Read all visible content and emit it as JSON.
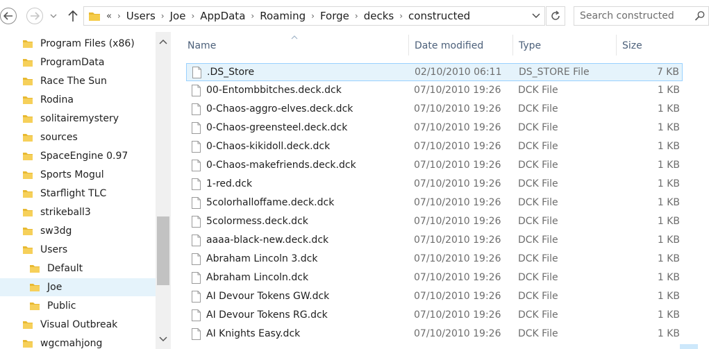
{
  "address": {
    "overflow": "«",
    "crumbs": [
      "Users",
      "Joe",
      "AppData",
      "Roaming",
      "Forge",
      "decks",
      "constructed"
    ]
  },
  "search": {
    "placeholder": "Search constructed"
  },
  "nav": {
    "items": [
      {
        "label": "Program Files (x86)",
        "indent": 0
      },
      {
        "label": "ProgramData",
        "indent": 0
      },
      {
        "label": "Race The Sun",
        "indent": 0
      },
      {
        "label": "Rodina",
        "indent": 0
      },
      {
        "label": "solitairemystery",
        "indent": 0
      },
      {
        "label": "sources",
        "indent": 0
      },
      {
        "label": "SpaceEngine 0.97",
        "indent": 0
      },
      {
        "label": "Sports Mogul",
        "indent": 0
      },
      {
        "label": "Starflight TLC",
        "indent": 0
      },
      {
        "label": "strikeball3",
        "indent": 0
      },
      {
        "label": "sw3dg",
        "indent": 0
      },
      {
        "label": "Users",
        "indent": 0
      },
      {
        "label": "Default",
        "indent": 1
      },
      {
        "label": "Joe",
        "indent": 1,
        "selected": true
      },
      {
        "label": "Public",
        "indent": 1
      },
      {
        "label": "Visual Outbreak",
        "indent": 0
      },
      {
        "label": "wgcmahjong",
        "indent": 0
      }
    ]
  },
  "columns": {
    "name": "Name",
    "date": "Date modified",
    "type": "Type",
    "size": "Size"
  },
  "files": [
    {
      "name": ".DS_Store",
      "date": "02/10/2010 06:11",
      "type": "DS_STORE File",
      "size": "7 KB",
      "selected": true
    },
    {
      "name": "00-Entombbitches.deck.dck",
      "date": "07/10/2010 19:26",
      "type": "DCK File",
      "size": "1 KB"
    },
    {
      "name": "0-Chaos-aggro-elves.deck.dck",
      "date": "07/10/2010 19:26",
      "type": "DCK File",
      "size": "1 KB"
    },
    {
      "name": "0-Chaos-greensteel.deck.dck",
      "date": "07/10/2010 19:26",
      "type": "DCK File",
      "size": "1 KB"
    },
    {
      "name": "0-Chaos-kikidoll.deck.dck",
      "date": "07/10/2010 19:26",
      "type": "DCK File",
      "size": "1 KB"
    },
    {
      "name": "0-Chaos-makefriends.deck.dck",
      "date": "07/10/2010 19:26",
      "type": "DCK File",
      "size": "1 KB"
    },
    {
      "name": "1-red.dck",
      "date": "07/10/2010 19:26",
      "type": "DCK File",
      "size": "1 KB"
    },
    {
      "name": "5colorhalloffame.deck.dck",
      "date": "07/10/2010 19:26",
      "type": "DCK File",
      "size": "1 KB"
    },
    {
      "name": "5colormess.deck.dck",
      "date": "07/10/2010 19:26",
      "type": "DCK File",
      "size": "1 KB"
    },
    {
      "name": "aaaa-black-new.deck.dck",
      "date": "07/10/2010 19:26",
      "type": "DCK File",
      "size": "1 KB"
    },
    {
      "name": "Abraham Lincoln 3.dck",
      "date": "07/10/2010 19:26",
      "type": "DCK File",
      "size": "1 KB"
    },
    {
      "name": "Abraham Lincoln.dck",
      "date": "07/10/2010 19:26",
      "type": "DCK File",
      "size": "1 KB"
    },
    {
      "name": "AI Devour Tokens GW.dck",
      "date": "07/10/2010 19:26",
      "type": "DCK File",
      "size": "1 KB"
    },
    {
      "name": "AI Devour Tokens RG.dck",
      "date": "07/10/2010 19:26",
      "type": "DCK File",
      "size": "1 KB"
    },
    {
      "name": "AI Knights Easy.dck",
      "date": "07/10/2010 19:26",
      "type": "DCK File",
      "size": "1 KB"
    }
  ],
  "icons": {
    "back": "back-arrow-icon",
    "forward": "forward-arrow-icon",
    "recent": "chevron-down-icon",
    "up": "up-arrow-icon",
    "folder": "folder-icon",
    "file": "file-icon",
    "refresh": "refresh-icon",
    "search": "search-icon"
  },
  "colors": {
    "selection_bg": "#e5f3fb",
    "selection_border": "#99d1ff",
    "folder": "#e8b931",
    "header_text": "#4c607a"
  }
}
